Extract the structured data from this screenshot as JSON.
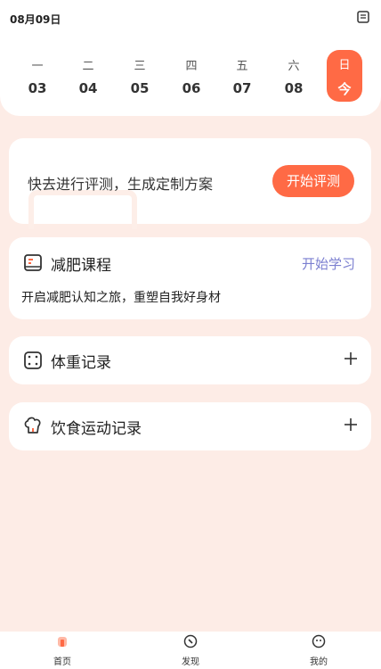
{
  "status_date": "08月09日",
  "week": [
    {
      "weekday": "一",
      "day": "03"
    },
    {
      "weekday": "二",
      "day": "04"
    },
    {
      "weekday": "三",
      "day": "05"
    },
    {
      "weekday": "四",
      "day": "06"
    },
    {
      "weekday": "五",
      "day": "07"
    },
    {
      "weekday": "六",
      "day": "08"
    },
    {
      "weekday": "日",
      "day": "今"
    }
  ],
  "assessment": {
    "text": "快去进行评测，生成定制方案",
    "button": "开始评测"
  },
  "course": {
    "title": "减肥课程",
    "link": "开始学习",
    "desc": "开启减肥认知之旅，重塑自我好身材"
  },
  "weight": {
    "title": "体重记录"
  },
  "diet": {
    "title": "饮食运动记录"
  },
  "tabs": [
    {
      "label": "首页"
    },
    {
      "label": "发现"
    },
    {
      "label": "我的"
    }
  ],
  "colors": {
    "accent": "#ff6a45",
    "link": "#7b7fd0",
    "background": "#fdece6"
  }
}
